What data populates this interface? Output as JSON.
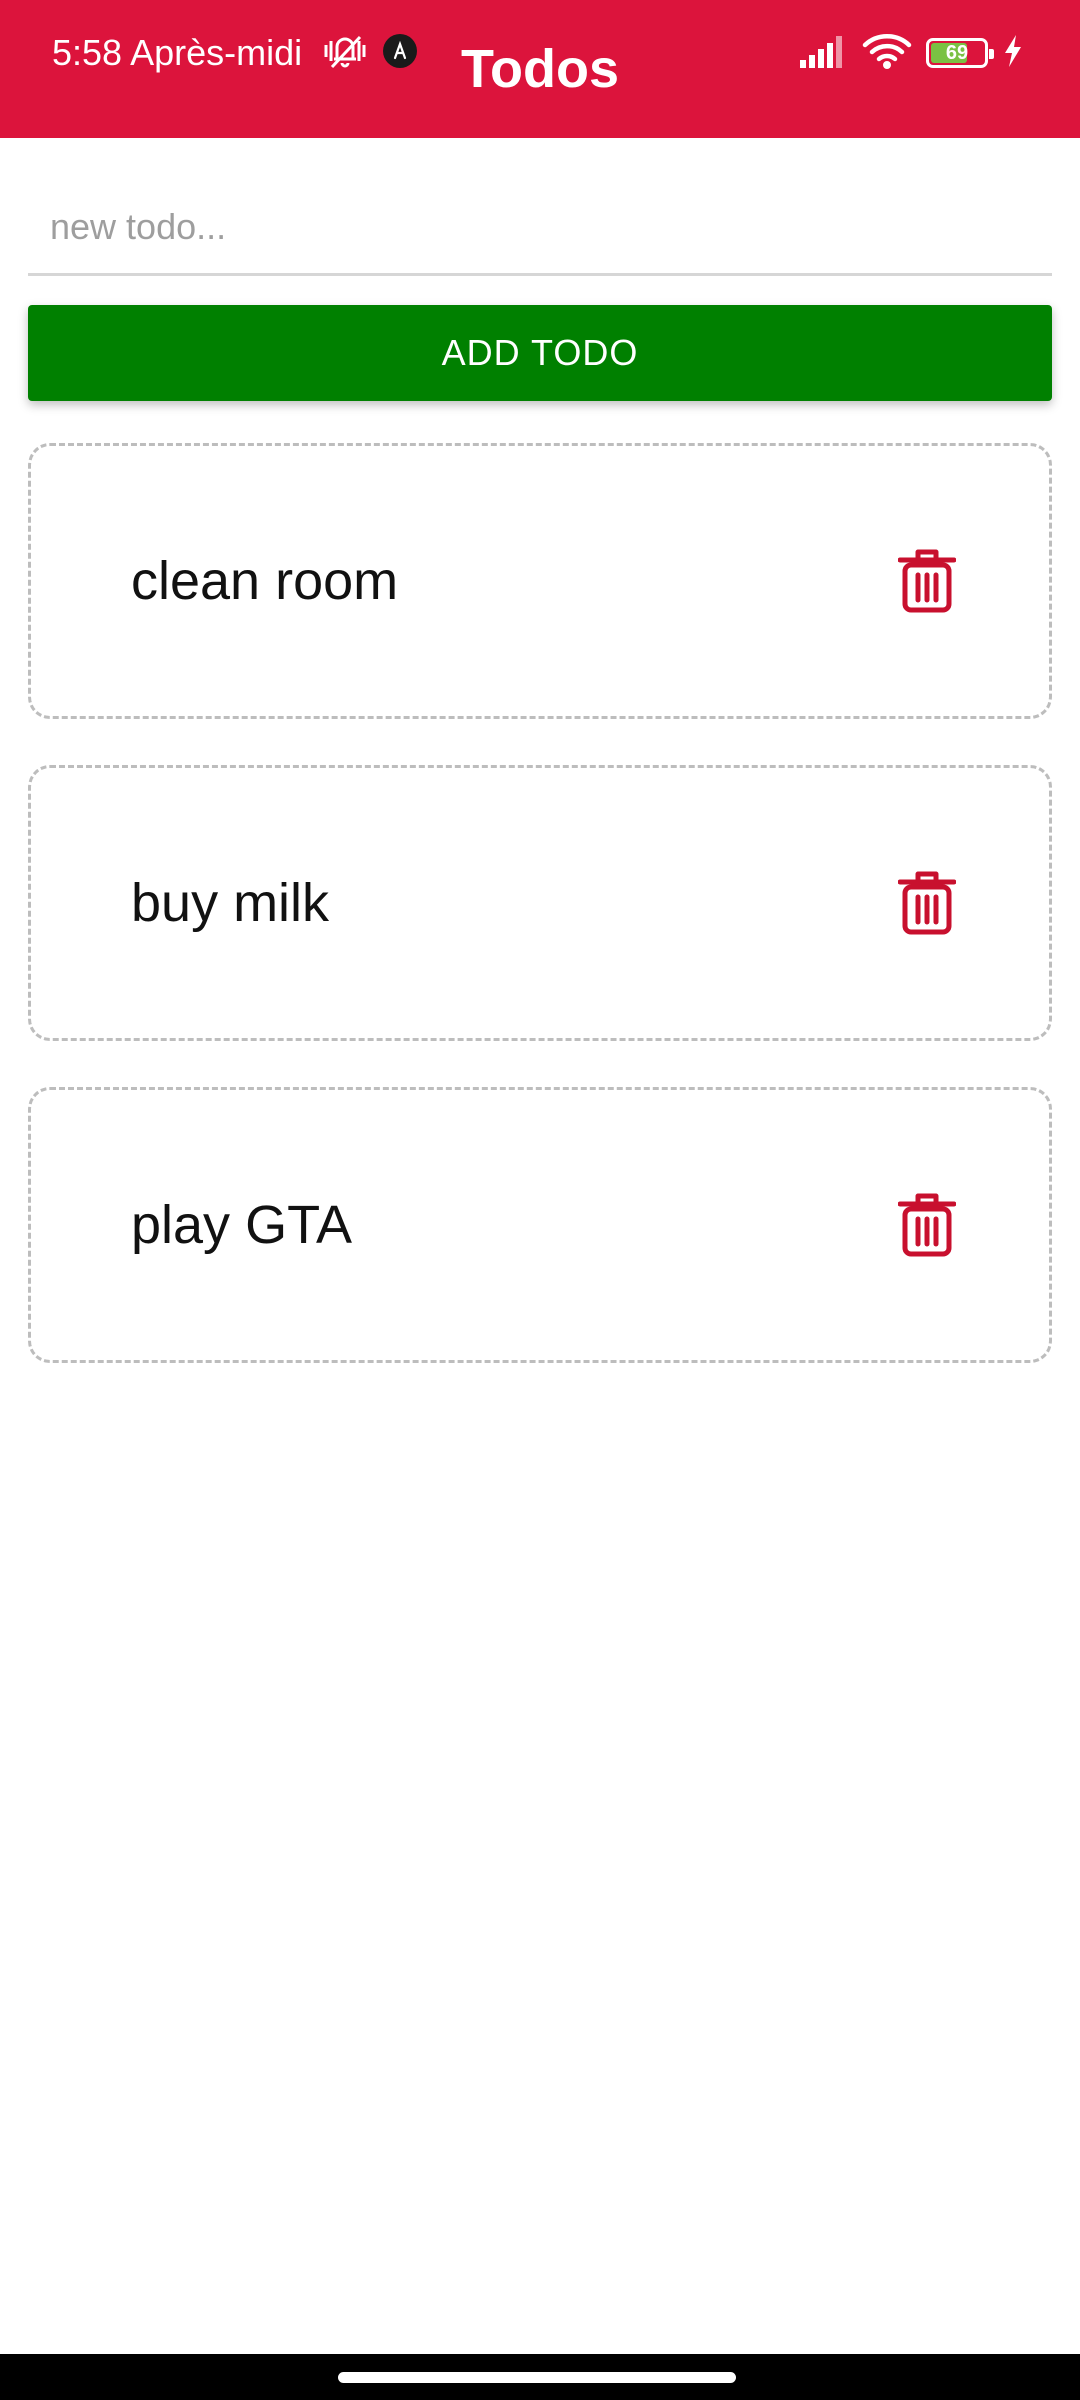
{
  "status_bar": {
    "time": "5:58 Après-midi",
    "battery_level": "69",
    "battery_fraction": 0.69,
    "icons_left": [
      "vibrate-off-icon",
      "notification-app-icon"
    ],
    "icons_right": [
      "signal-icon",
      "wifi-icon",
      "battery-icon",
      "charging-icon"
    ]
  },
  "header": {
    "title": "Todos",
    "background_color": "#dc143c"
  },
  "input": {
    "placeholder": "new todo...",
    "value": ""
  },
  "add_button": {
    "label": "ADD TODO",
    "color": "#008000"
  },
  "todos": [
    {
      "text": "clean room",
      "delete_icon": "trash-icon"
    },
    {
      "text": "buy milk",
      "delete_icon": "trash-icon"
    },
    {
      "text": "play GTA",
      "delete_icon": "trash-icon"
    }
  ],
  "colors": {
    "delete_icon": "#c8102e",
    "card_border": "#bdbdbd"
  }
}
